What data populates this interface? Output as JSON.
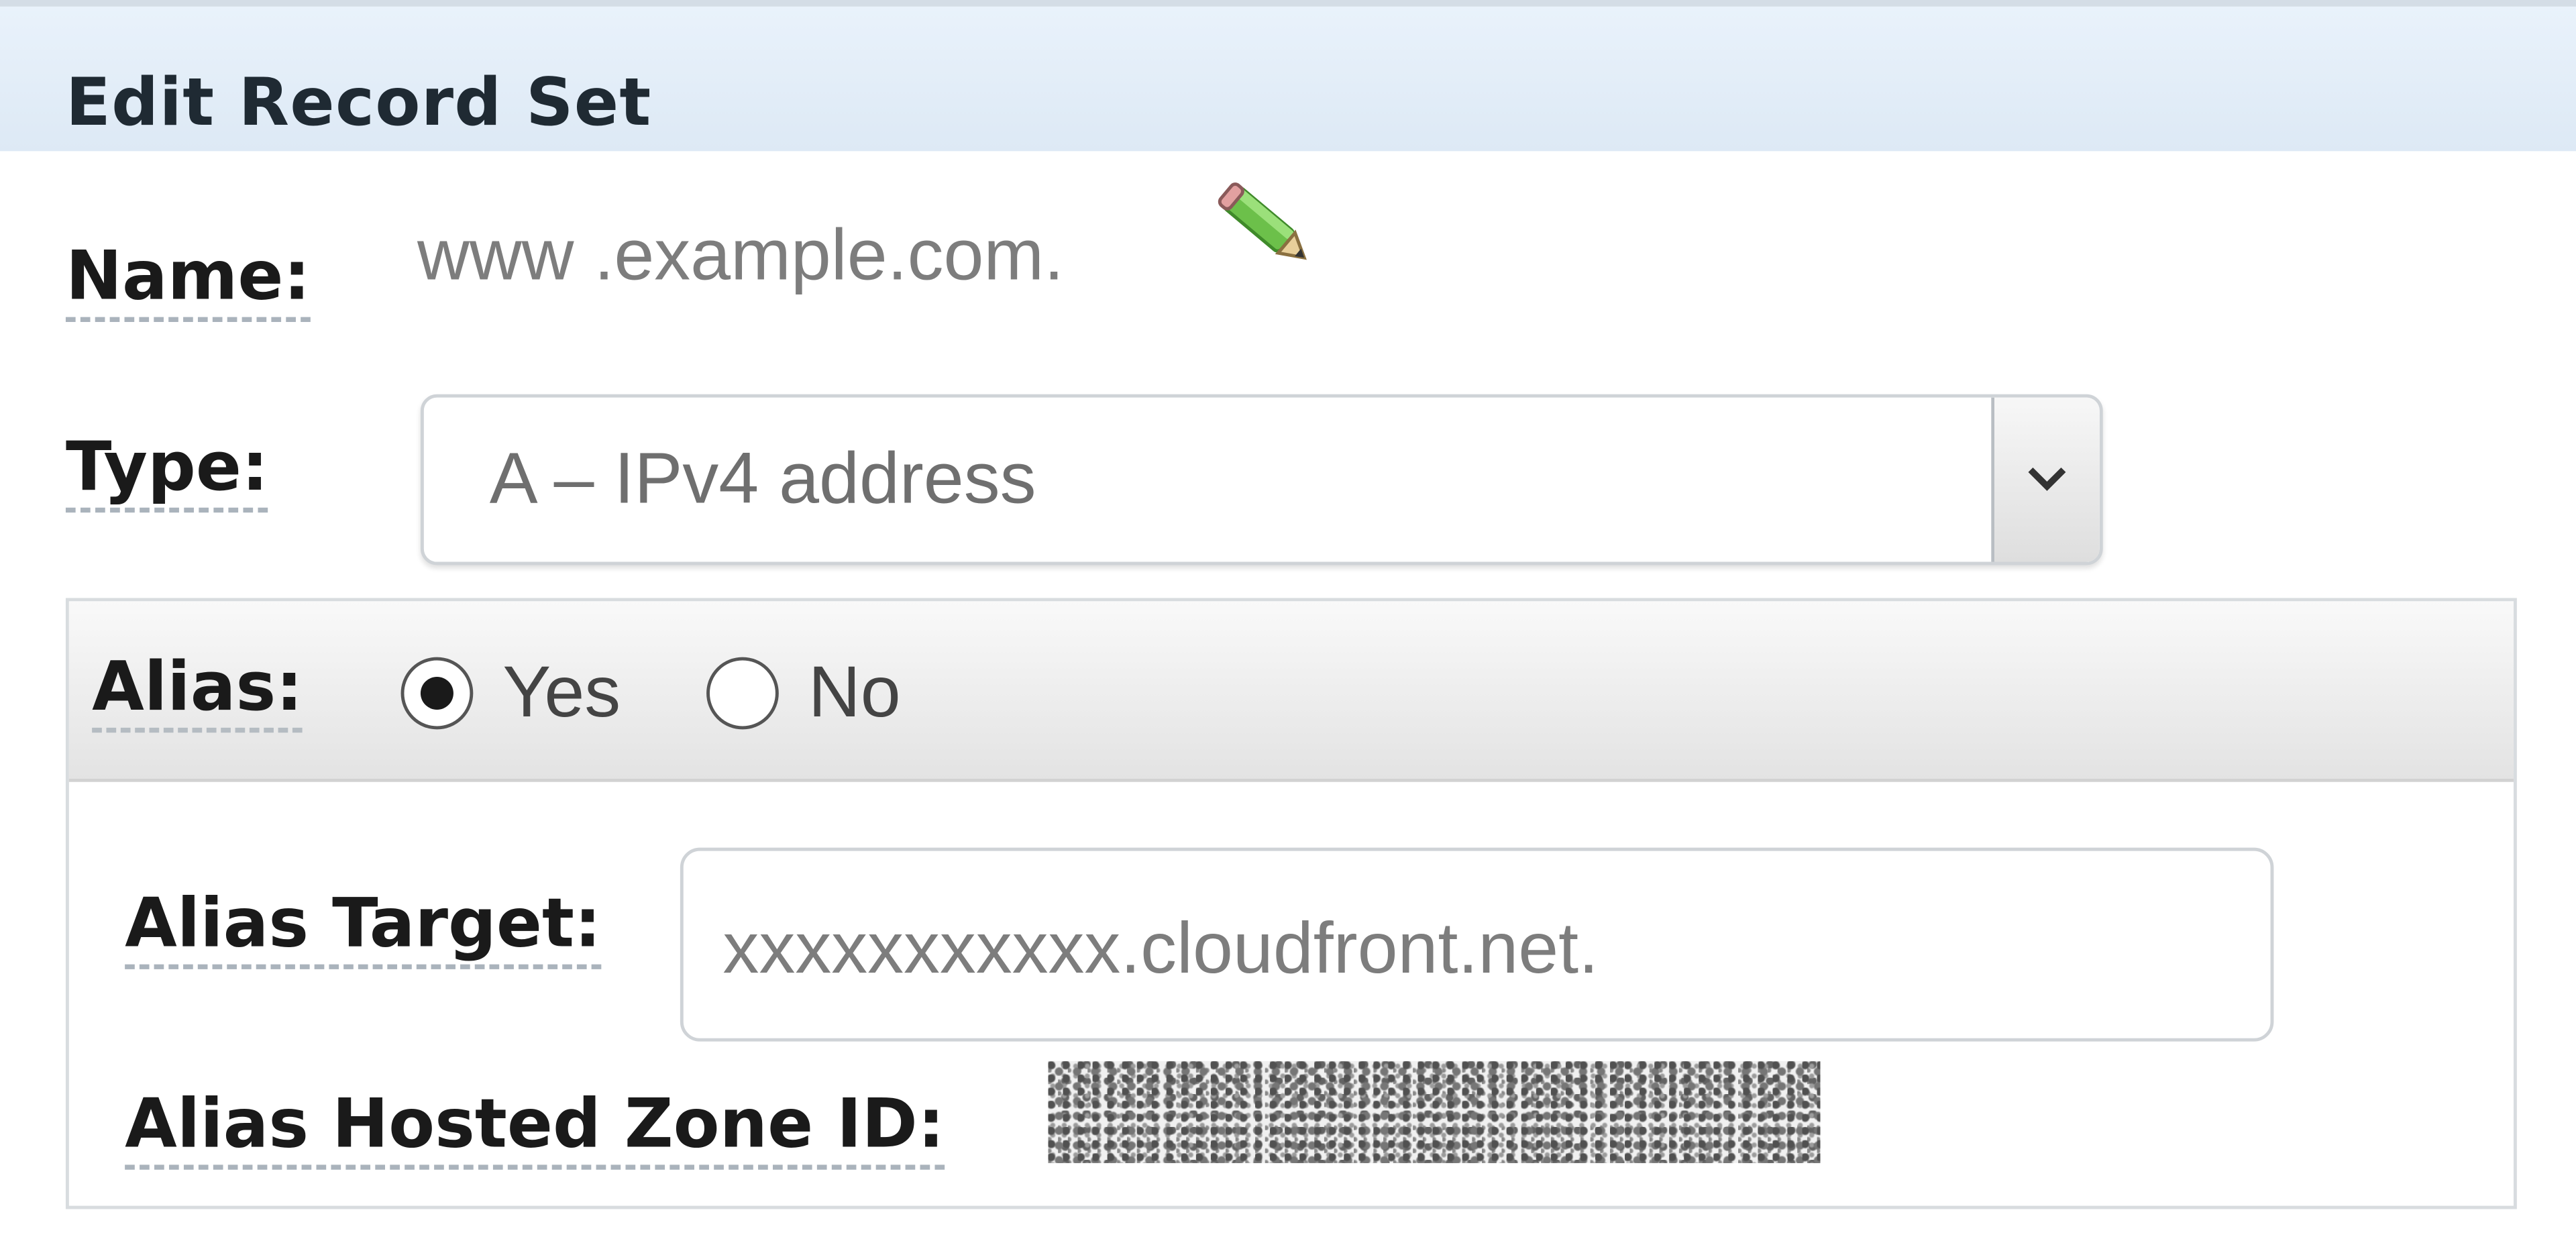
{
  "header": {
    "title": "Edit Record Set"
  },
  "form": {
    "name_label": "Name:",
    "name_value": "www .example.com.",
    "type_label": "Type:",
    "type_value": "A – IPv4 address",
    "alias_label": "Alias:",
    "alias_options": [
      "Yes",
      "No"
    ],
    "alias_selected": "Yes",
    "alias_target_label": "Alias Target:",
    "alias_target_value": "xxxxxxxxxxx.cloudfront.net.",
    "alias_hosted_zone_label": "Alias Hosted Zone ID:"
  },
  "icons": {
    "edit": "pencil-icon",
    "dropdown": "chevron-down-icon"
  },
  "colors": {
    "header_bg": "#e3edf8",
    "pencil": "#6cc04a"
  }
}
